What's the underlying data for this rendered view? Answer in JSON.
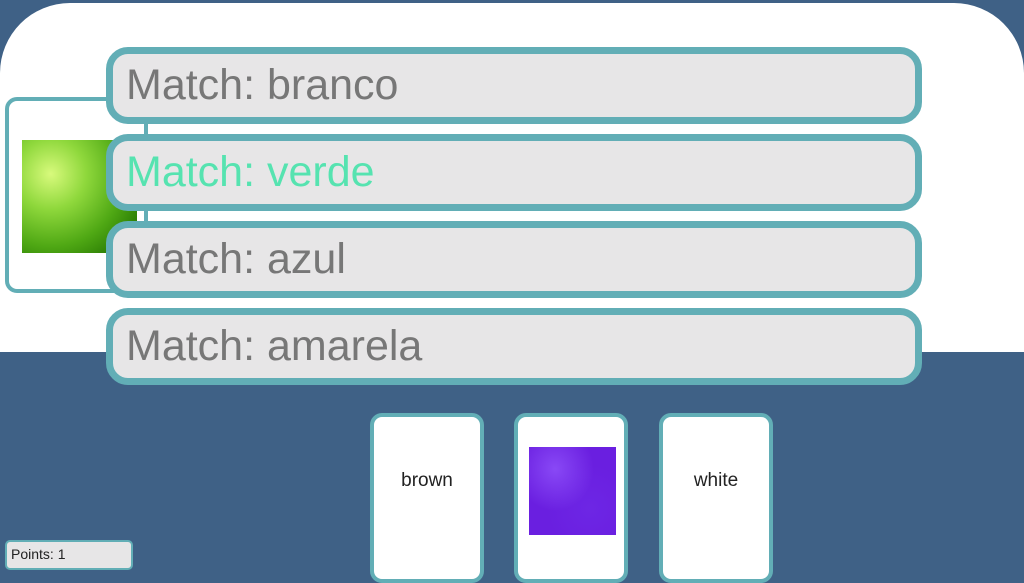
{
  "prompts": [
    {
      "label": "Match: branco",
      "state": "default"
    },
    {
      "label": "Match: verde",
      "state": "active"
    },
    {
      "label": "Match: azul",
      "state": "default"
    },
    {
      "label": "Match: amarela",
      "state": "default"
    }
  ],
  "selected_image": {
    "color": "#4fa814",
    "description": "green-texture"
  },
  "answer_cards": [
    {
      "type": "text",
      "label": "brown"
    },
    {
      "type": "image",
      "color": "#6a1fe0"
    },
    {
      "type": "text",
      "label": "white"
    }
  ],
  "score": {
    "label": "Points: 1"
  },
  "colors": {
    "background": "#3f6186",
    "panel": "#ffffff",
    "border": "#62aeb6",
    "row_fill": "#e7e6e7",
    "text": "#777777",
    "active_text": "#56e3b0"
  }
}
